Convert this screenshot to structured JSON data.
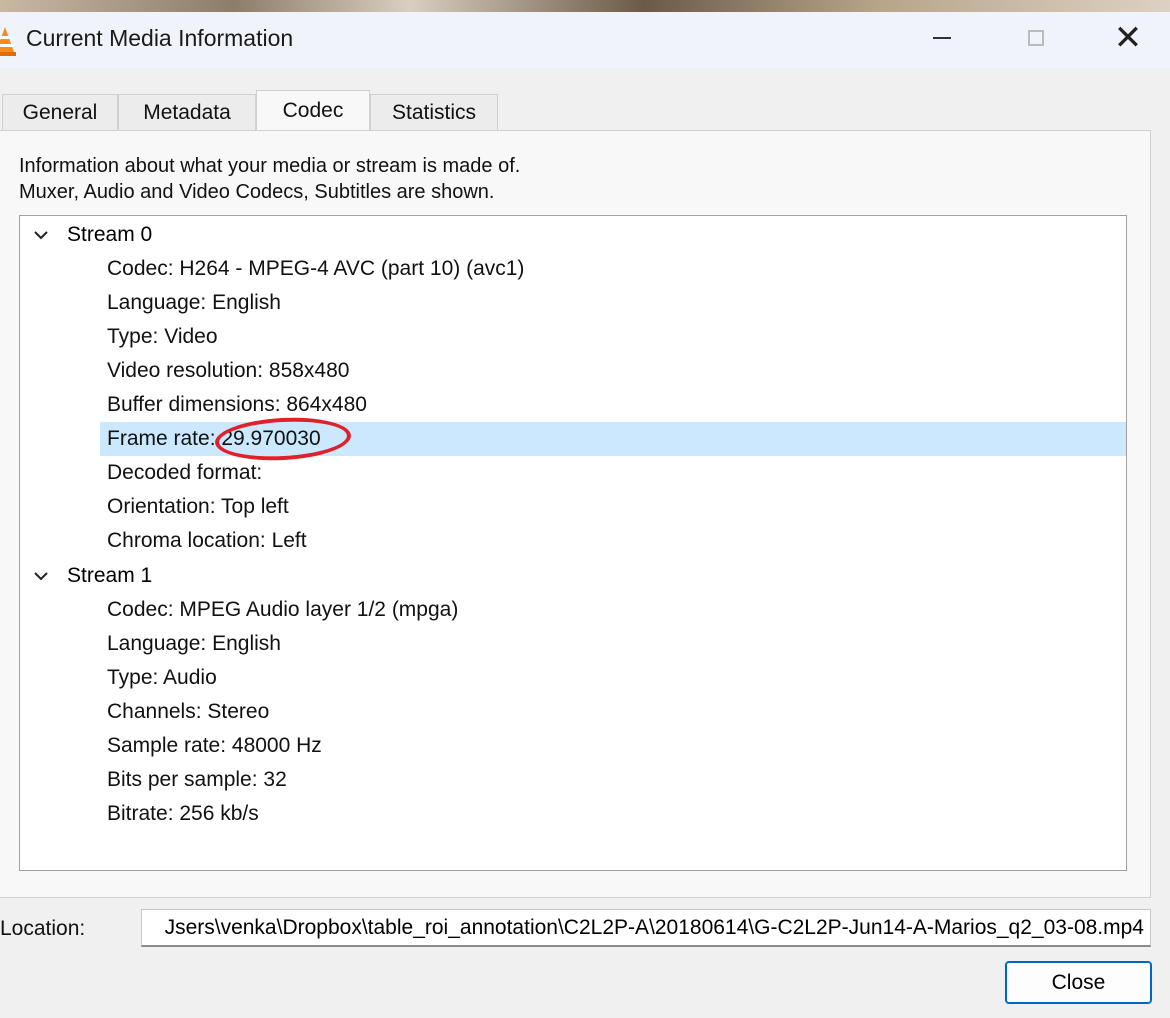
{
  "window": {
    "title": "Current Media Information",
    "app_icon": "vlc-cone-icon"
  },
  "tabs": [
    {
      "label": "General",
      "active": false
    },
    {
      "label": "Metadata",
      "active": false
    },
    {
      "label": "Codec",
      "active": true
    },
    {
      "label": "Statistics",
      "active": false
    }
  ],
  "codec": {
    "info_line1": "Information about what your media or stream is made of.",
    "info_line2": "Muxer, Audio and Video Codecs, Subtitles are shown.",
    "streams": [
      {
        "label": "Stream 0",
        "expanded": true,
        "props": [
          "Codec: H264 - MPEG-4 AVC (part 10) (avc1)",
          "Language: English",
          "Type: Video",
          "Video resolution: 858x480",
          "Buffer dimensions: 864x480",
          "Frame rate: 29.970030",
          "Decoded format:",
          "Orientation: Top left",
          "Chroma location: Left"
        ]
      },
      {
        "label": "Stream 1",
        "expanded": true,
        "props": [
          "Codec: MPEG Audio layer 1/2 (mpga)",
          "Language: English",
          "Type: Audio",
          "Channels: Stereo",
          "Sample rate: 48000 Hz",
          "Bits per sample: 32",
          "Bitrate: 256 kb/s"
        ]
      }
    ],
    "selected_prop": "Frame rate: 29.970030",
    "annotation_color": "#e0202a"
  },
  "location": {
    "label": "Location:",
    "value": "Jsers\\venka\\Dropbox\\table_roi_annotation\\C2L2P-A\\20180614\\G-C2L2P-Jun14-A-Marios_q2_03-08.mp4"
  },
  "buttons": {
    "close": "Close"
  },
  "colors": {
    "selection": "#cce8ff",
    "button_border": "#0067c0"
  }
}
